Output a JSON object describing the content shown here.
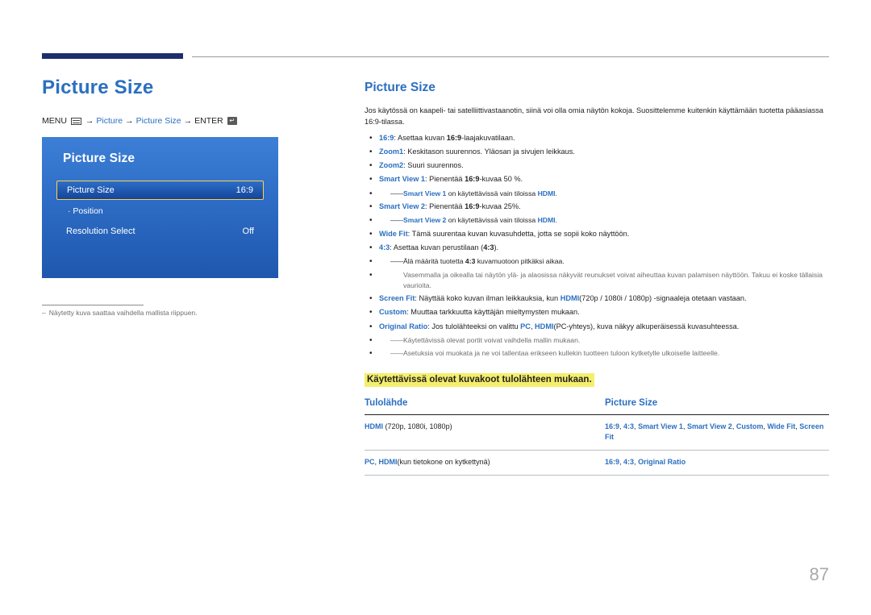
{
  "left": {
    "title": "Picture Size",
    "breadcrumb": {
      "menu": "MENU",
      "menu_icon": "menu-icon",
      "arrow1": "→",
      "item1": "Picture",
      "arrow2": "→",
      "item2": "Picture Size",
      "arrow3": "→",
      "enter": "ENTER",
      "enter_icon": "enter-icon"
    },
    "osd": {
      "title": "Picture Size",
      "rows": [
        {
          "label": "Picture Size",
          "value": "16:9"
        },
        {
          "label": "· Position",
          "value": ""
        },
        {
          "label": "Resolution Select",
          "value": "Off"
        }
      ]
    },
    "note": {
      "dash": "–",
      "text": "Näytetty kuva saattaa vaihdella mallista riippuen."
    }
  },
  "right": {
    "title": "Picture Size",
    "intro": "Jos käytössä on kaapeli- tai satelliittivastaanotin, siinä voi olla omia näytön kokoja. Suosittelemme kuitenkin käyttämään tuotetta pääasiassa 16:9-tilassa.",
    "bullets": [
      {
        "type": "bullet",
        "parts": [
          {
            "t": "16:9",
            "s": "bblue"
          },
          {
            "t": ": Asettaa kuvan ",
            "s": ""
          },
          {
            "t": "16:9",
            "s": "b"
          },
          {
            "t": "-laajakuvatilaan.",
            "s": ""
          }
        ]
      },
      {
        "type": "bullet",
        "parts": [
          {
            "t": "Zoom1",
            "s": "bblue"
          },
          {
            "t": ": Keskitason suurennos. Yläosan ja sivujen leikkaus.",
            "s": ""
          }
        ]
      },
      {
        "type": "bullet",
        "parts": [
          {
            "t": "Zoom2",
            "s": "bblue"
          },
          {
            "t": ": Suuri suurennos.",
            "s": ""
          }
        ]
      },
      {
        "type": "bullet",
        "parts": [
          {
            "t": "Smart View 1",
            "s": "bblue"
          },
          {
            "t": ": Pienentää ",
            "s": ""
          },
          {
            "t": "16:9",
            "s": "b"
          },
          {
            "t": "-kuvaa 50 %.",
            "s": ""
          }
        ]
      },
      {
        "type": "dash",
        "parts": [
          {
            "t": "Smart View 1",
            "s": "bblue"
          },
          {
            "t": " on käytettävissä vain tiloissa ",
            "s": ""
          },
          {
            "t": "HDMI",
            "s": "bblue"
          },
          {
            "t": ".",
            "s": ""
          }
        ]
      },
      {
        "type": "bullet",
        "parts": [
          {
            "t": "Smart View 2",
            "s": "bblue"
          },
          {
            "t": ": Pienentää ",
            "s": ""
          },
          {
            "t": "16:9",
            "s": "b"
          },
          {
            "t": "-kuvaa 25%.",
            "s": ""
          }
        ]
      },
      {
        "type": "dash",
        "parts": [
          {
            "t": "Smart View 2",
            "s": "bblue"
          },
          {
            "t": " on käytettävissä vain tiloissa ",
            "s": ""
          },
          {
            "t": "HDMI",
            "s": "bblue"
          },
          {
            "t": ".",
            "s": ""
          }
        ]
      },
      {
        "type": "bullet",
        "parts": [
          {
            "t": "Wide Fit",
            "s": "bblue"
          },
          {
            "t": ": Tämä suurentaa kuvan kuvasuhdetta, jotta se sopii koko näyttöön.",
            "s": ""
          }
        ]
      },
      {
        "type": "bullet",
        "parts": [
          {
            "t": "4:3",
            "s": "bblue"
          },
          {
            "t": ": Asettaa kuvan perustilaan (",
            "s": ""
          },
          {
            "t": "4:3",
            "s": "b"
          },
          {
            "t": ").",
            "s": ""
          }
        ]
      },
      {
        "type": "dash",
        "parts": [
          {
            "t": "Älä määritä tuotetta ",
            "s": ""
          },
          {
            "t": "4:3",
            "s": "b"
          },
          {
            "t": " kuvamuotoon pitkäksi aikaa.",
            "s": ""
          }
        ]
      },
      {
        "type": "plain-gray",
        "parts": [
          {
            "t": "Vasemmalla ja oikealla tai näytön ylä- ja alaosissa näkyvät reunukset voivat aiheuttaa kuvan palamisen näyttöön. Takuu ei koske tällaisia vaurioita.",
            "s": ""
          }
        ]
      },
      {
        "type": "bullet",
        "parts": [
          {
            "t": "Screen Fit",
            "s": "bblue"
          },
          {
            "t": ": Näyttää koko kuvan ilman leikkauksia, kun ",
            "s": ""
          },
          {
            "t": "HDMI",
            "s": "bblue"
          },
          {
            "t": "(720p / 1080i / 1080p) -signaaleja otetaan vastaan.",
            "s": ""
          }
        ]
      },
      {
        "type": "bullet",
        "parts": [
          {
            "t": "Custom",
            "s": "bblue"
          },
          {
            "t": ": Muuttaa tarkkuutta käyttäjän mieltymysten mukaan.",
            "s": ""
          }
        ]
      },
      {
        "type": "bullet",
        "parts": [
          {
            "t": "Original Ratio",
            "s": "bblue"
          },
          {
            "t": ": Jos tulolähteeksi on valittu ",
            "s": ""
          },
          {
            "t": "PC",
            "s": "bblue"
          },
          {
            "t": ", ",
            "s": ""
          },
          {
            "t": "HDMI",
            "s": "bblue"
          },
          {
            "t": "(PC-yhteys), kuva näkyy alkuperäisessä kuvasuhteessa.",
            "s": ""
          }
        ]
      },
      {
        "type": "dash-gray",
        "parts": [
          {
            "t": "Käytettävissä olevat portit voivat vaihdella mallin mukaan.",
            "s": ""
          }
        ]
      },
      {
        "type": "dash-gray",
        "parts": [
          {
            "t": "Asetuksia voi muokata ja ne voi tallentaa erikseen kullekin tuotteen tuloon kytketylle ulkoiselle laitteelle.",
            "s": ""
          }
        ]
      }
    ],
    "highlight_heading": "Käytettävissä olevat kuvakoot tulolähteen mukaan.",
    "table": {
      "headers": [
        "Tulolähde",
        "Picture Size"
      ],
      "rows": [
        {
          "source": [
            {
              "t": "HDMI",
              "s": "bblue"
            },
            {
              "t": " (720p, 1080i, 1080p)",
              "s": ""
            }
          ],
          "sizes": [
            {
              "t": "16:9",
              "s": "bblue"
            },
            {
              "t": ", ",
              "s": ""
            },
            {
              "t": "4:3",
              "s": "bblue"
            },
            {
              "t": ", ",
              "s": ""
            },
            {
              "t": "Smart View 1",
              "s": "bblue"
            },
            {
              "t": ", ",
              "s": ""
            },
            {
              "t": "Smart View 2",
              "s": "bblue"
            },
            {
              "t": ", ",
              "s": ""
            },
            {
              "t": "Custom",
              "s": "bblue"
            },
            {
              "t": ", ",
              "s": ""
            },
            {
              "t": "Wide Fit",
              "s": "bblue"
            },
            {
              "t": ", ",
              "s": ""
            },
            {
              "t": "Screen Fit",
              "s": "bblue"
            }
          ]
        },
        {
          "source": [
            {
              "t": "PC",
              "s": "bblue"
            },
            {
              "t": ", ",
              "s": ""
            },
            {
              "t": "HDMI",
              "s": "bblue"
            },
            {
              "t": "(kun tietokone on kytkettynä)",
              "s": ""
            }
          ],
          "sizes": [
            {
              "t": "16:9",
              "s": "bblue"
            },
            {
              "t": ", ",
              "s": ""
            },
            {
              "t": "4:3",
              "s": "bblue"
            },
            {
              "t": ", ",
              "s": ""
            },
            {
              "t": "Original Ratio",
              "s": "bblue"
            }
          ]
        }
      ]
    }
  },
  "page_number": "87"
}
